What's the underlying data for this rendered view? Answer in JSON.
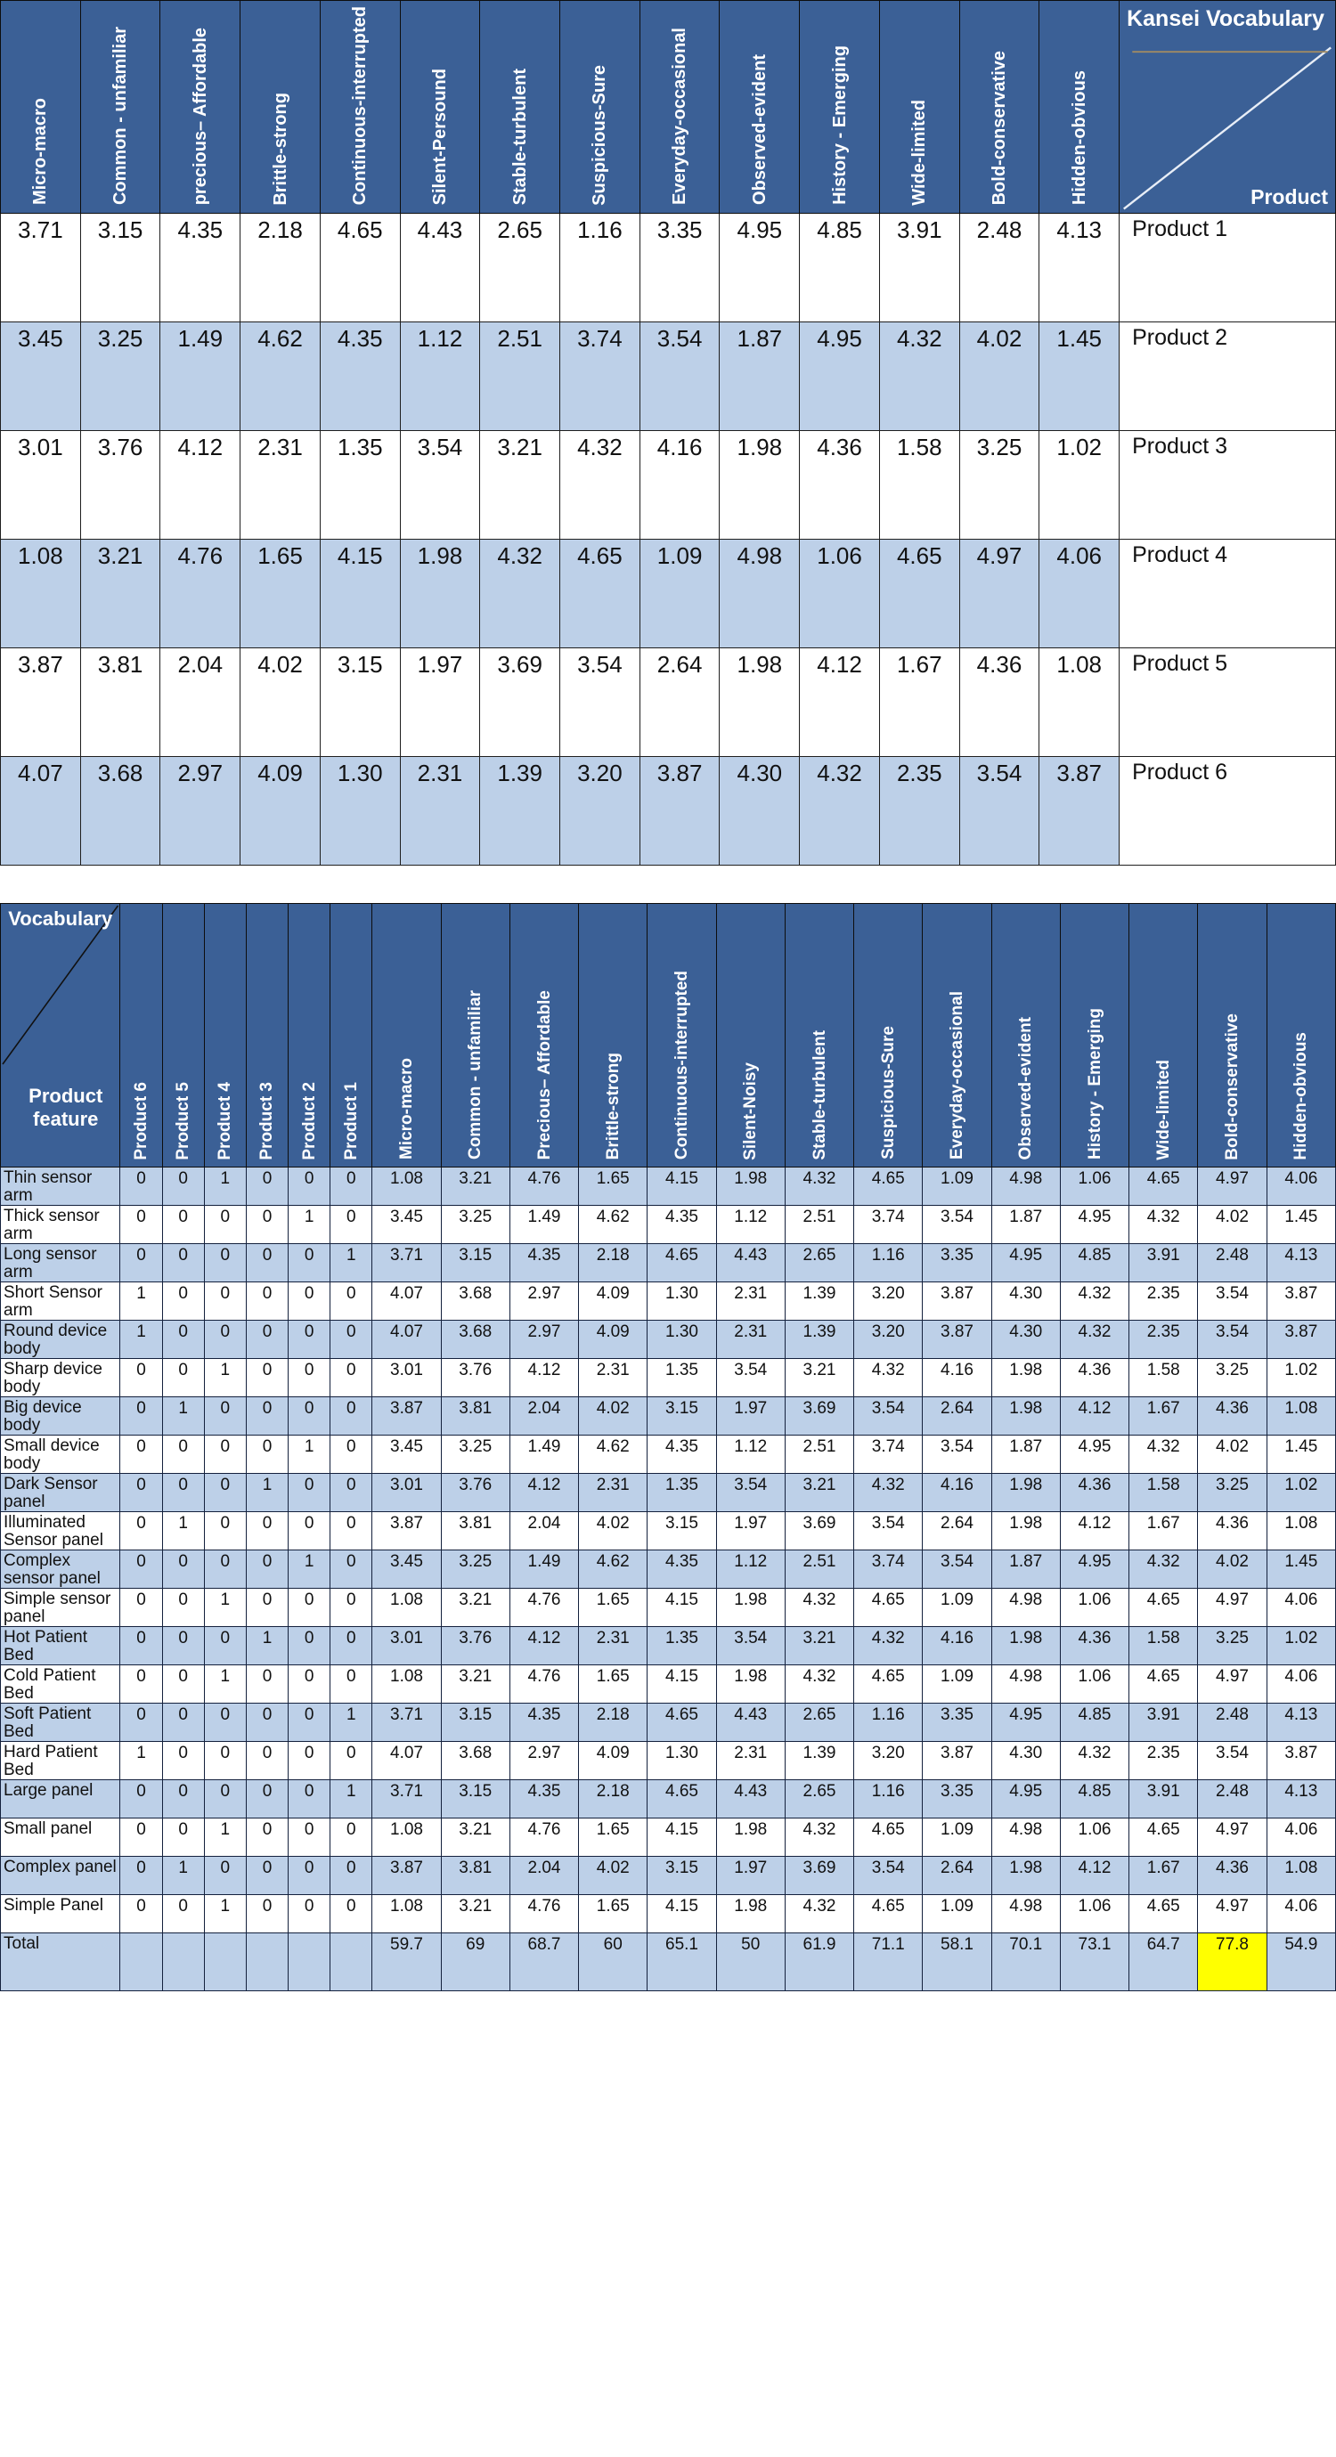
{
  "colors": {
    "header_blue": "#3b6096",
    "band_blue": "#bdd0e8",
    "highlight_yellow": "#ffff00",
    "white": "#ffffff"
  },
  "table1": {
    "corner": {
      "top_label": "Kansei Vocabulary",
      "bottom_label": "Product"
    },
    "columns": [
      "Micro-macro",
      "Common - unfamiliar",
      "precious– Affordable",
      "Brittle-strong",
      "Continuous-interrupted",
      "Silent-Persound",
      "Stable-turbulent",
      "Suspicious-Sure",
      "Everyday-occasional",
      "Observed-evident",
      "History - Emerging",
      "Wide-limited",
      "Bold-conservative",
      "Hidden-obvious"
    ],
    "rows": [
      {
        "product": "Product 1",
        "values": [
          "3.71",
          "3.15",
          "4.35",
          "2.18",
          "4.65",
          "4.43",
          "2.65",
          "1.16",
          "3.35",
          "4.95",
          "4.85",
          "3.91",
          "2.48",
          "4.13"
        ]
      },
      {
        "product": "Product 2",
        "values": [
          "3.45",
          "3.25",
          "1.49",
          "4.62",
          "4.35",
          "1.12",
          "2.51",
          "3.74",
          "3.54",
          "1.87",
          "4.95",
          "4.32",
          "4.02",
          "1.45"
        ]
      },
      {
        "product": "Product 3",
        "values": [
          "3.01",
          "3.76",
          "4.12",
          "2.31",
          "1.35",
          "3.54",
          "3.21",
          "4.32",
          "4.16",
          "1.98",
          "4.36",
          "1.58",
          "3.25",
          "1.02"
        ]
      },
      {
        "product": "Product 4",
        "values": [
          "1.08",
          "3.21",
          "4.76",
          "1.65",
          "4.15",
          "1.98",
          "4.32",
          "4.65",
          "1.09",
          "4.98",
          "1.06",
          "4.65",
          "4.97",
          "4.06"
        ]
      },
      {
        "product": "Product 5",
        "values": [
          "3.87",
          "3.81",
          "2.04",
          "4.02",
          "3.15",
          "1.97",
          "3.69",
          "3.54",
          "2.64",
          "1.98",
          "4.12",
          "1.67",
          "4.36",
          "1.08"
        ]
      },
      {
        "product": "Product 6",
        "values": [
          "4.07",
          "3.68",
          "2.97",
          "4.09",
          "1.30",
          "2.31",
          "1.39",
          "3.20",
          "3.87",
          "4.30",
          "4.32",
          "2.35",
          "3.54",
          "3.87"
        ]
      }
    ]
  },
  "table2": {
    "corner": {
      "top_label": "Vocabulary",
      "bottom_label": "Product feature"
    },
    "product_columns": [
      "Product 6",
      "Product 5",
      "Product 4",
      "Product 3",
      "Product 2",
      "Product 1"
    ],
    "vocab_columns": [
      "Micro-macro",
      "Common - unfamiliar",
      "Precious– Affordable",
      "Brittle-strong",
      "Continuous-interrupted",
      "Silent-Noisy",
      "Stable-turbulent",
      "Suspicious-Sure",
      "Everyday-occasional",
      "Observed-evident",
      "History - Emerging",
      "Wide-limited",
      "Bold-conservative",
      "Hidden-obvious"
    ],
    "rows": [
      {
        "feature": "Thin sensor arm",
        "flags": [
          "0",
          "0",
          "1",
          "0",
          "0",
          "0"
        ],
        "values": [
          "1.08",
          "3.21",
          "4.76",
          "1.65",
          "4.15",
          "1.98",
          "4.32",
          "4.65",
          "1.09",
          "4.98",
          "1.06",
          "4.65",
          "4.97",
          "4.06"
        ]
      },
      {
        "feature": "Thick sensor arm",
        "flags": [
          "0",
          "0",
          "0",
          "0",
          "1",
          "0"
        ],
        "values": [
          "3.45",
          "3.25",
          "1.49",
          "4.62",
          "4.35",
          "1.12",
          "2.51",
          "3.74",
          "3.54",
          "1.87",
          "4.95",
          "4.32",
          "4.02",
          "1.45"
        ]
      },
      {
        "feature": "Long sensor arm",
        "flags": [
          "0",
          "0",
          "0",
          "0",
          "0",
          "1"
        ],
        "values": [
          "3.71",
          "3.15",
          "4.35",
          "2.18",
          "4.65",
          "4.43",
          "2.65",
          "1.16",
          "3.35",
          "4.95",
          "4.85",
          "3.91",
          "2.48",
          "4.13"
        ]
      },
      {
        "feature": "Short Sensor arm",
        "flags": [
          "1",
          "0",
          "0",
          "0",
          "0",
          "0"
        ],
        "values": [
          "4.07",
          "3.68",
          "2.97",
          "4.09",
          "1.30",
          "2.31",
          "1.39",
          "3.20",
          "3.87",
          "4.30",
          "4.32",
          "2.35",
          "3.54",
          "3.87"
        ]
      },
      {
        "feature": "Round device body",
        "flags": [
          "1",
          "0",
          "0",
          "0",
          "0",
          "0"
        ],
        "values": [
          "4.07",
          "3.68",
          "2.97",
          "4.09",
          "1.30",
          "2.31",
          "1.39",
          "3.20",
          "3.87",
          "4.30",
          "4.32",
          "2.35",
          "3.54",
          "3.87"
        ]
      },
      {
        "feature": "Sharp device body",
        "flags": [
          "0",
          "0",
          "1",
          "0",
          "0",
          "0"
        ],
        "values": [
          "3.01",
          "3.76",
          "4.12",
          "2.31",
          "1.35",
          "3.54",
          "3.21",
          "4.32",
          "4.16",
          "1.98",
          "4.36",
          "1.58",
          "3.25",
          "1.02"
        ]
      },
      {
        "feature": "Big device body",
        "flags": [
          "0",
          "1",
          "0",
          "0",
          "0",
          "0"
        ],
        "values": [
          "3.87",
          "3.81",
          "2.04",
          "4.02",
          "3.15",
          "1.97",
          "3.69",
          "3.54",
          "2.64",
          "1.98",
          "4.12",
          "1.67",
          "4.36",
          "1.08"
        ]
      },
      {
        "feature": "Small device body",
        "flags": [
          "0",
          "0",
          "0",
          "0",
          "1",
          "0"
        ],
        "values": [
          "3.45",
          "3.25",
          "1.49",
          "4.62",
          "4.35",
          "1.12",
          "2.51",
          "3.74",
          "3.54",
          "1.87",
          "4.95",
          "4.32",
          "4.02",
          "1.45"
        ]
      },
      {
        "feature": "Dark Sensor panel",
        "flags": [
          "0",
          "0",
          "0",
          "1",
          "0",
          "0"
        ],
        "values": [
          "3.01",
          "3.76",
          "4.12",
          "2.31",
          "1.35",
          "3.54",
          "3.21",
          "4.32",
          "4.16",
          "1.98",
          "4.36",
          "1.58",
          "3.25",
          "1.02"
        ]
      },
      {
        "feature": "Illuminated Sensor panel",
        "flags": [
          "0",
          "1",
          "0",
          "0",
          "0",
          "0"
        ],
        "values": [
          "3.87",
          "3.81",
          "2.04",
          "4.02",
          "3.15",
          "1.97",
          "3.69",
          "3.54",
          "2.64",
          "1.98",
          "4.12",
          "1.67",
          "4.36",
          "1.08"
        ]
      },
      {
        "feature": "Complex sensor panel",
        "flags": [
          "0",
          "0",
          "0",
          "0",
          "1",
          "0"
        ],
        "values": [
          "3.45",
          "3.25",
          "1.49",
          "4.62",
          "4.35",
          "1.12",
          "2.51",
          "3.74",
          "3.54",
          "1.87",
          "4.95",
          "4.32",
          "4.02",
          "1.45"
        ]
      },
      {
        "feature": "Simple sensor panel",
        "flags": [
          "0",
          "0",
          "1",
          "0",
          "0",
          "0"
        ],
        "values": [
          "1.08",
          "3.21",
          "4.76",
          "1.65",
          "4.15",
          "1.98",
          "4.32",
          "4.65",
          "1.09",
          "4.98",
          "1.06",
          "4.65",
          "4.97",
          "4.06"
        ]
      },
      {
        "feature": "Hot Patient Bed",
        "flags": [
          "0",
          "0",
          "0",
          "1",
          "0",
          "0"
        ],
        "values": [
          "3.01",
          "3.76",
          "4.12",
          "2.31",
          "1.35",
          "3.54",
          "3.21",
          "4.32",
          "4.16",
          "1.98",
          "4.36",
          "1.58",
          "3.25",
          "1.02"
        ]
      },
      {
        "feature": "Cold Patient Bed",
        "flags": [
          "0",
          "0",
          "1",
          "0",
          "0",
          "0"
        ],
        "values": [
          "1.08",
          "3.21",
          "4.76",
          "1.65",
          "4.15",
          "1.98",
          "4.32",
          "4.65",
          "1.09",
          "4.98",
          "1.06",
          "4.65",
          "4.97",
          "4.06"
        ]
      },
      {
        "feature": "Soft Patient Bed",
        "flags": [
          "0",
          "0",
          "0",
          "0",
          "0",
          "1"
        ],
        "values": [
          "3.71",
          "3.15",
          "4.35",
          "2.18",
          "4.65",
          "4.43",
          "2.65",
          "1.16",
          "3.35",
          "4.95",
          "4.85",
          "3.91",
          "2.48",
          "4.13"
        ]
      },
      {
        "feature": "Hard Patient Bed",
        "flags": [
          "1",
          "0",
          "0",
          "0",
          "0",
          "0"
        ],
        "values": [
          "4.07",
          "3.68",
          "2.97",
          "4.09",
          "1.30",
          "2.31",
          "1.39",
          "3.20",
          "3.87",
          "4.30",
          "4.32",
          "2.35",
          "3.54",
          "3.87"
        ]
      },
      {
        "feature": "Large panel",
        "flags": [
          "0",
          "0",
          "0",
          "0",
          "0",
          "1"
        ],
        "values": [
          "3.71",
          "3.15",
          "4.35",
          "2.18",
          "4.65",
          "4.43",
          "2.65",
          "1.16",
          "3.35",
          "4.95",
          "4.85",
          "3.91",
          "2.48",
          "4.13"
        ]
      },
      {
        "feature": "Small panel",
        "flags": [
          "0",
          "0",
          "1",
          "0",
          "0",
          "0"
        ],
        "values": [
          "1.08",
          "3.21",
          "4.76",
          "1.65",
          "4.15",
          "1.98",
          "4.32",
          "4.65",
          "1.09",
          "4.98",
          "1.06",
          "4.65",
          "4.97",
          "4.06"
        ]
      },
      {
        "feature": "Complex panel",
        "flags": [
          "0",
          "1",
          "0",
          "0",
          "0",
          "0"
        ],
        "values": [
          "3.87",
          "3.81",
          "2.04",
          "4.02",
          "3.15",
          "1.97",
          "3.69",
          "3.54",
          "2.64",
          "1.98",
          "4.12",
          "1.67",
          "4.36",
          "1.08"
        ]
      },
      {
        "feature": "Simple Panel",
        "flags": [
          "0",
          "0",
          "1",
          "0",
          "0",
          "0"
        ],
        "values": [
          "1.08",
          "3.21",
          "4.76",
          "1.65",
          "4.15",
          "1.98",
          "4.32",
          "4.65",
          "1.09",
          "4.98",
          "1.06",
          "4.65",
          "4.97",
          "4.06"
        ]
      }
    ],
    "total": {
      "label": "Total",
      "flags": [
        "",
        "",
        "",
        "",
        "",
        ""
      ],
      "values": [
        "59.7",
        "69",
        "68.7",
        "60",
        "65.1",
        "50",
        "61.9",
        "71.1",
        "58.1",
        "70.1",
        "73.1",
        "64.7",
        "77.8",
        "54.9"
      ],
      "highlight_index": 12
    }
  }
}
